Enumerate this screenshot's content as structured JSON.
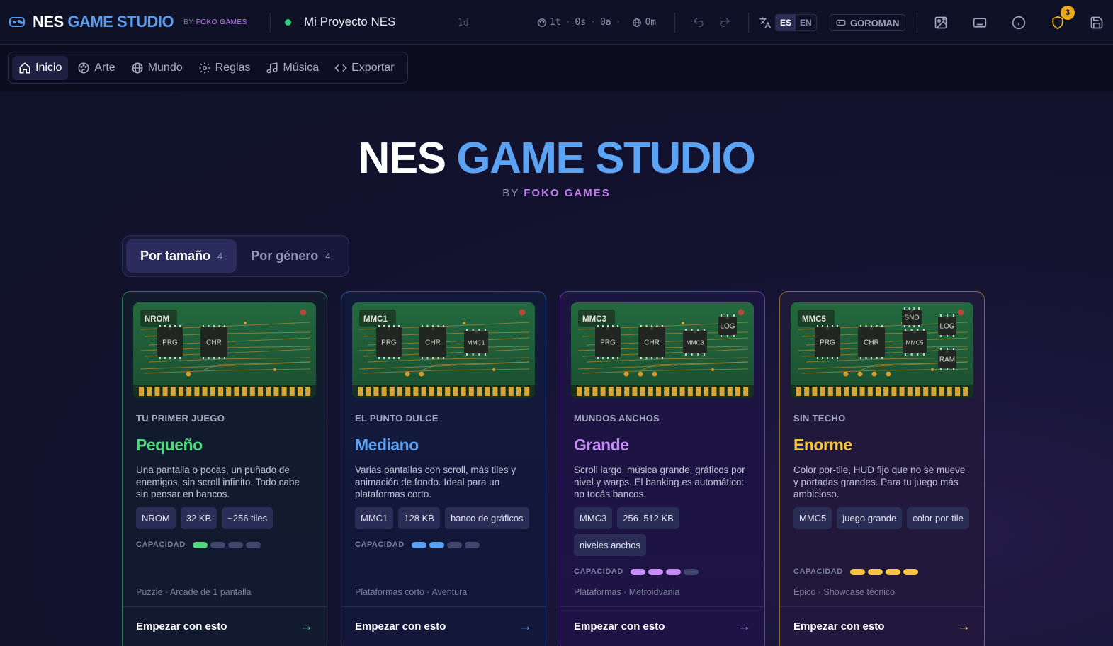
{
  "app": {
    "title_main": "NES",
    "title_accent": "GAME STUDIO",
    "by": "BY",
    "by_brand": "FOKO GAMES"
  },
  "project": {
    "name": "Mi Proyecto NES",
    "age": "1d",
    "status_color": "#2fd07a"
  },
  "stats": {
    "tiles": "1t",
    "sprites": "0s",
    "audio": "0a",
    "maps": "0m"
  },
  "lang": {
    "es": "ES",
    "en": "EN",
    "active": "ES"
  },
  "controller_button": "GOROMAN",
  "notifications_count": "3",
  "nav": {
    "tabs": [
      {
        "label": "Inicio",
        "icon": "home-icon",
        "active": true
      },
      {
        "label": "Arte",
        "icon": "palette-icon"
      },
      {
        "label": "Mundo",
        "icon": "globe-icon"
      },
      {
        "label": "Reglas",
        "icon": "gear-icon"
      },
      {
        "label": "Música",
        "icon": "music-icon"
      },
      {
        "label": "Exportar",
        "icon": "code-icon"
      }
    ]
  },
  "hero": {
    "title_main": "NES",
    "title_accent": "GAME STUDIO",
    "by": "BY",
    "by_brand": "FOKO GAMES"
  },
  "segment": {
    "items": [
      {
        "label": "Por tamaño",
        "count": "4",
        "active": true
      },
      {
        "label": "Por género",
        "count": "4"
      }
    ]
  },
  "cards": [
    {
      "eyebrow": "TU PRIMER JUEGO",
      "name": "Pequeño",
      "color": "#4fd97f",
      "desc": "Una pantalla o pocas, un puñado de enemigos, sin scroll infinito. Todo cabe sin pensar en bancos.",
      "chips": [
        "NROM",
        "32 KB",
        "~256 tiles"
      ],
      "capacity_label": "CAPACIDAD",
      "capacity": 1,
      "capacity_max": 4,
      "genres": "Puzzle · Arcade de 1 pantalla",
      "cta": "Empezar con esto",
      "pcb_mapper": "NROM",
      "pcb_chips": [
        "PRG",
        "CHR"
      ]
    },
    {
      "eyebrow": "EL PUNTO DULCE",
      "name": "Mediano",
      "color": "#5ba0f2",
      "desc": "Varias pantallas con scroll, más tiles y animación de fondo. Ideal para un plataformas corto.",
      "chips": [
        "MMC1",
        "128 KB",
        "banco de gráficos"
      ],
      "capacity_label": "CAPACIDAD",
      "capacity": 2,
      "capacity_max": 4,
      "genres": "Plataformas corto · Aventura",
      "cta": "Empezar con esto",
      "pcb_mapper": "MMC1",
      "pcb_chips": [
        "PRG",
        "CHR",
        "MMC1"
      ]
    },
    {
      "eyebrow": "MUNDOS ANCHOS",
      "name": "Grande",
      "color": "#c68cf5",
      "desc": "Scroll largo, música grande, gráficos por nivel y warps. El banking es automático: no tocás bancos.",
      "chips": [
        "MMC3",
        "256–512 KB",
        "niveles anchos"
      ],
      "capacity_label": "CAPACIDAD",
      "capacity": 3,
      "capacity_max": 4,
      "genres": "Plataformas · Metroidvania",
      "cta": "Empezar con esto",
      "pcb_mapper": "MMC3",
      "pcb_chips": [
        "PRG",
        "CHR",
        "MMC3",
        "LOG"
      ]
    },
    {
      "eyebrow": "SIN TECHO",
      "name": "Enorme",
      "color": "#f5c542",
      "desc": "Color por-tile, HUD fijo que no se mueve y portadas grandes. Para tu juego más ambicioso.",
      "chips": [
        "MMC5",
        "juego grande",
        "color por-tile"
      ],
      "capacity_label": "CAPACIDAD",
      "capacity": 4,
      "capacity_max": 4,
      "genres": "Épico · Showcase técnico",
      "cta": "Empezar con esto",
      "pcb_mapper": "MMC5",
      "pcb_chips": [
        "PRG",
        "CHR",
        "MMC5",
        "SND",
        "LOG",
        "RAM"
      ]
    }
  ]
}
